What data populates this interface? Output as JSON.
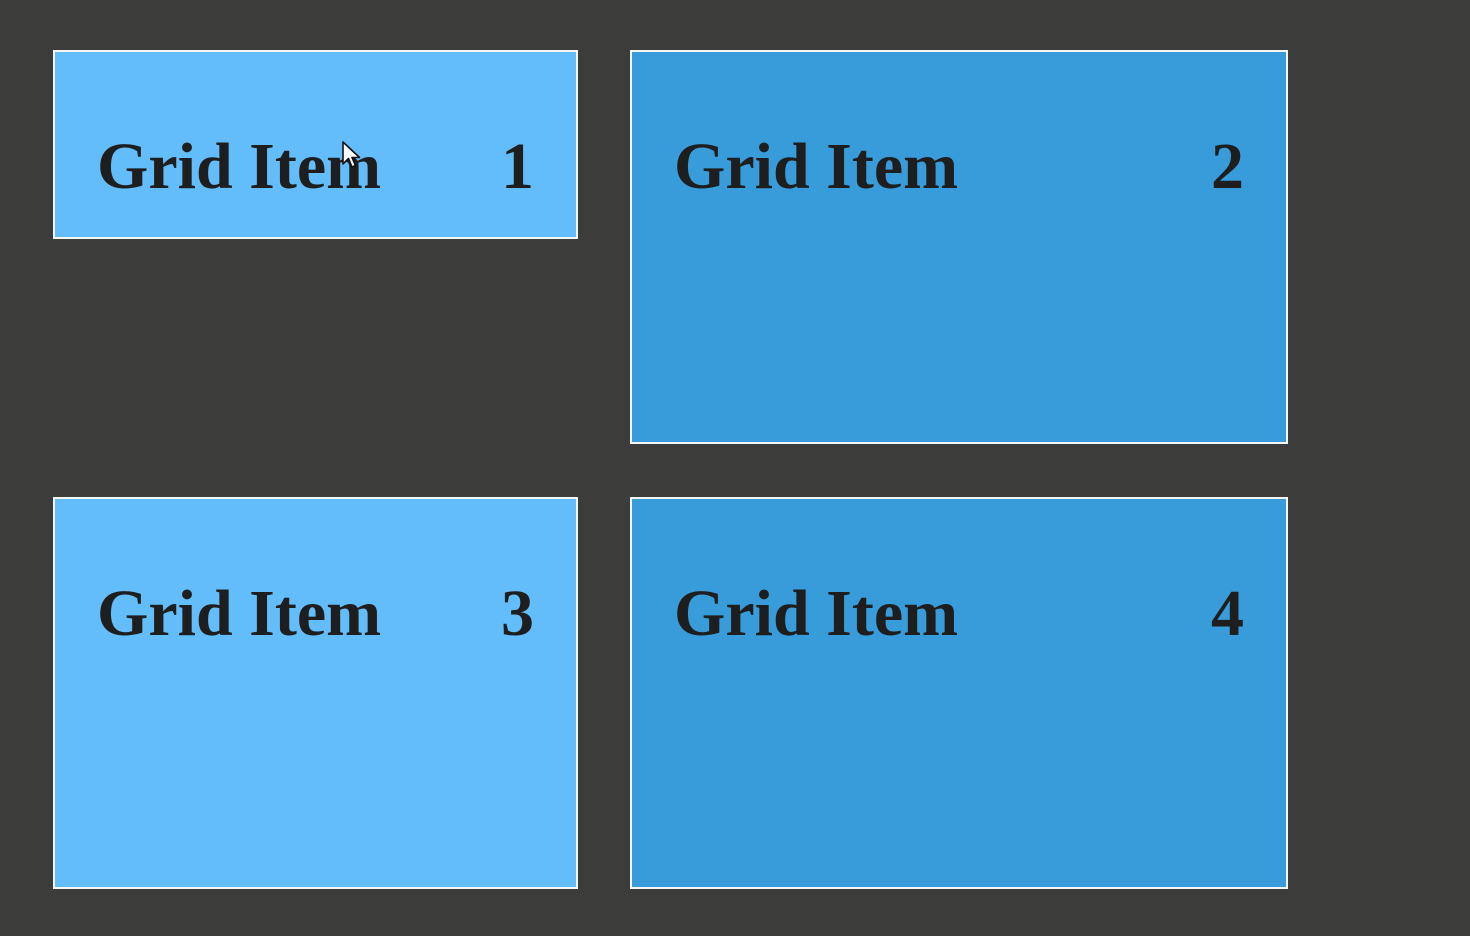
{
  "colors": {
    "background": "#3c3c3a",
    "light_item": "#62bdfa",
    "dark_item": "#379cd9",
    "border": "#f4f6f8",
    "text": "#1e1e1e"
  },
  "grid": {
    "items": [
      {
        "label": "Grid Item",
        "number": "1",
        "tone": "light"
      },
      {
        "label": "Grid Item",
        "number": "2",
        "tone": "dark"
      },
      {
        "label": "Grid Item",
        "number": "3",
        "tone": "light"
      },
      {
        "label": "Grid Item",
        "number": "4",
        "tone": "dark"
      }
    ]
  },
  "cursor": {
    "icon": "mouse-pointer-icon"
  }
}
